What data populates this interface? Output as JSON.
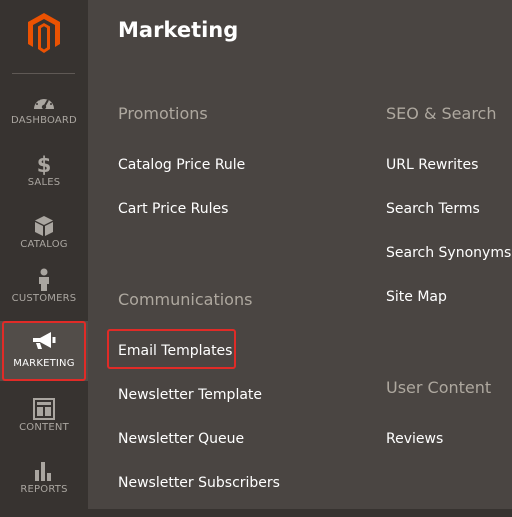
{
  "sidebar": {
    "items": [
      {
        "label": "DASHBOARD",
        "icon": "dashboard-icon"
      },
      {
        "label": "SALES",
        "icon": "dollar-icon"
      },
      {
        "label": "CATALOG",
        "icon": "box-icon"
      },
      {
        "label": "CUSTOMERS",
        "icon": "person-icon"
      },
      {
        "label": "MARKETING",
        "icon": "megaphone-icon"
      },
      {
        "label": "CONTENT",
        "icon": "layout-icon"
      },
      {
        "label": "REPORTS",
        "icon": "bar-chart-icon"
      }
    ],
    "active": "MARKETING"
  },
  "panel": {
    "title": "Marketing",
    "promotions": {
      "title": "Promotions",
      "links": [
        "Catalog Price Rule",
        "Cart Price Rules"
      ]
    },
    "communications": {
      "title": "Communications",
      "links": [
        "Email Templates",
        "Newsletter Template",
        "Newsletter Queue",
        "Newsletter Subscribers"
      ]
    },
    "seo": {
      "title": "SEO & Search",
      "links": [
        "URL Rewrites",
        "Search Terms",
        "Search Synonyms",
        "Site Map"
      ]
    },
    "user_content": {
      "title": "User Content",
      "links": [
        "Reviews"
      ]
    }
  },
  "colors": {
    "rail_bg": "#373330",
    "panel_bg": "#4a4542",
    "brand_orange": "#eb5202",
    "highlight_red": "#e02b27"
  }
}
